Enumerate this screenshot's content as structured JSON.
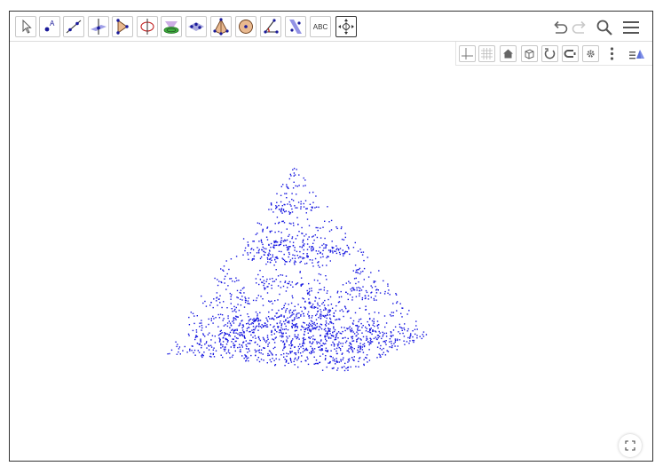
{
  "toolbar": {
    "tools": [
      {
        "icon": "move-arrow-icon"
      },
      {
        "icon": "point-icon"
      },
      {
        "icon": "line-icon"
      },
      {
        "icon": "perpendicular-line-icon"
      },
      {
        "icon": "polygon-icon"
      },
      {
        "icon": "circle-axis-icon"
      },
      {
        "icon": "intersect-surfaces-icon"
      },
      {
        "icon": "plane-through-points-icon"
      },
      {
        "icon": "pyramid-icon"
      },
      {
        "icon": "sphere-icon"
      },
      {
        "icon": "angle-icon"
      },
      {
        "icon": "reflect-about-plane-icon"
      },
      {
        "icon": "text-icon",
        "label": "ABC"
      },
      {
        "icon": "rotate-view-icon"
      }
    ],
    "selected_index": 13,
    "right_icons": [
      "undo-icon",
      "redo-icon",
      "search-icon",
      "menu-icon"
    ]
  },
  "style_bar": {
    "icons": [
      "axes-icon",
      "grid-icon",
      "home-icon",
      "view-cube-icon",
      "rotate-animation-icon",
      "projection-icon",
      "settings-icon",
      "more-vertical-icon",
      "toggle-style-bar-icon"
    ]
  },
  "fractal": {
    "point_count": 2000,
    "color": "#1515e0",
    "vertices": {
      "apex": [
        0,
        1.45,
        0
      ],
      "left": [
        -1.15,
        0,
        0.35
      ],
      "right": [
        1.15,
        0,
        -0.35
      ],
      "back": [
        0.45,
        0,
        1.1
      ],
      "front": [
        -0.3,
        0,
        -1.05
      ]
    }
  },
  "colors": {
    "accent": "#1515e0",
    "border": "#333333",
    "toolbar_border": "#c8c8c8",
    "icon_gray": "#666666"
  },
  "fullscreen_icon": "fullscreen-icon"
}
